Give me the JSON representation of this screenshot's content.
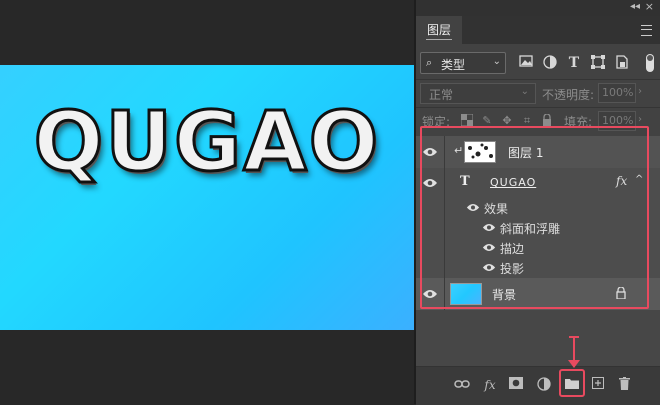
{
  "canvas": {
    "art_text": "QUGAO"
  },
  "panel": {
    "tab_label": "图层",
    "filter": {
      "label": "类型"
    },
    "blend_mode": "正常",
    "opacity_label": "不透明度:",
    "opacity_value": "100%",
    "lock_label": "锁定:",
    "fill_label": "填充:",
    "fill_value": "100%"
  },
  "layers": [
    {
      "name": "图层 1",
      "type": "pixel",
      "clipped": true
    },
    {
      "name": "QUGAO",
      "type": "text",
      "fx": "fx",
      "effects_label": "效果",
      "effects": [
        "斜面和浮雕",
        "描边",
        "投影"
      ]
    },
    {
      "name": "背景",
      "type": "background",
      "locked": true
    }
  ],
  "colors": {
    "highlight": "#e84a5f",
    "canvas_bg": "#22d8ff"
  }
}
